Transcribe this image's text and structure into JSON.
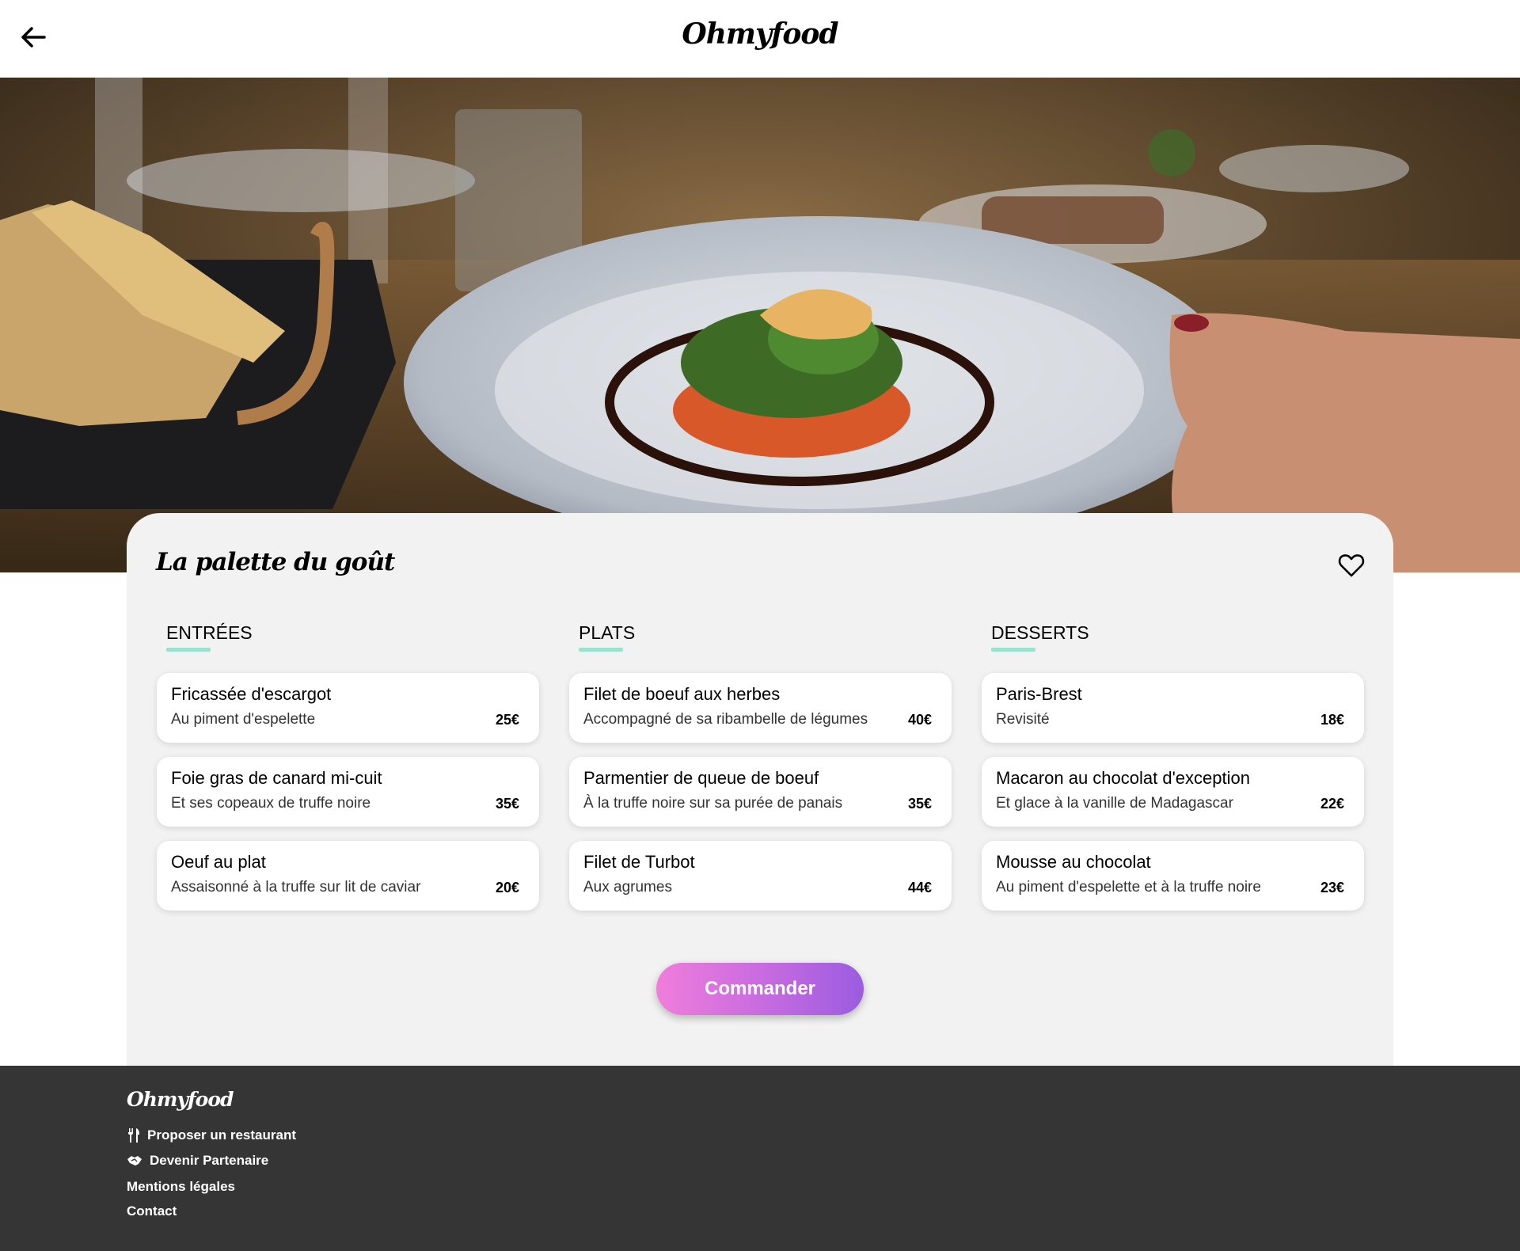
{
  "header": {
    "logo": "Ohmyfood",
    "back_icon": "arrow-left-icon"
  },
  "hero": {
    "image_subject": "plated-dish-photo"
  },
  "restaurant": {
    "name": "La palette du goût",
    "favorite_icon": "heart-outline-icon"
  },
  "menu": {
    "columns": [
      {
        "title": "ENTRÉES",
        "dishes": [
          {
            "name": "Fricassée d'escargot",
            "desc": "Au piment d'espelette",
            "price": "25€"
          },
          {
            "name": "Foie gras de canard mi-cuit",
            "desc": "Et ses copeaux de truffe noire",
            "price": "35€"
          },
          {
            "name": "Oeuf au plat",
            "desc": "Assaisonné à la truffe sur lit de caviar",
            "price": "20€"
          }
        ]
      },
      {
        "title": "PLATS",
        "dishes": [
          {
            "name": "Filet de boeuf aux herbes",
            "desc": "Accompagné de sa ribambelle de légumes",
            "price": "40€"
          },
          {
            "name": "Parmentier de queue de boeuf",
            "desc": "À la truffe noire sur sa purée de panais",
            "price": "35€"
          },
          {
            "name": "Filet de Turbot",
            "desc": "Aux agrumes",
            "price": "44€"
          }
        ]
      },
      {
        "title": "DESSERTS",
        "dishes": [
          {
            "name": "Paris-Brest",
            "desc": "Revisité",
            "price": "18€"
          },
          {
            "name": "Macaron au chocolat d'exception",
            "desc": "Et glace à la vanille de Madagascar",
            "price": "22€"
          },
          {
            "name": "Mousse au chocolat",
            "desc": "Au piment d'espelette et à la truffe noire",
            "price": "23€"
          }
        ]
      }
    ],
    "accent_color": "#99e2d0"
  },
  "order_button": {
    "label": "Commander",
    "gradient": [
      "#f07ddb",
      "#9b5ce0"
    ]
  },
  "footer": {
    "logo": "Ohmyfood",
    "links": [
      {
        "label": "Proposer un restaurant",
        "icon": "utensils-icon"
      },
      {
        "label": "Devenir Partenaire",
        "icon": "handshake-icon"
      },
      {
        "label": "Mentions légales"
      },
      {
        "label": "Contact"
      }
    ],
    "background": "#353535"
  }
}
